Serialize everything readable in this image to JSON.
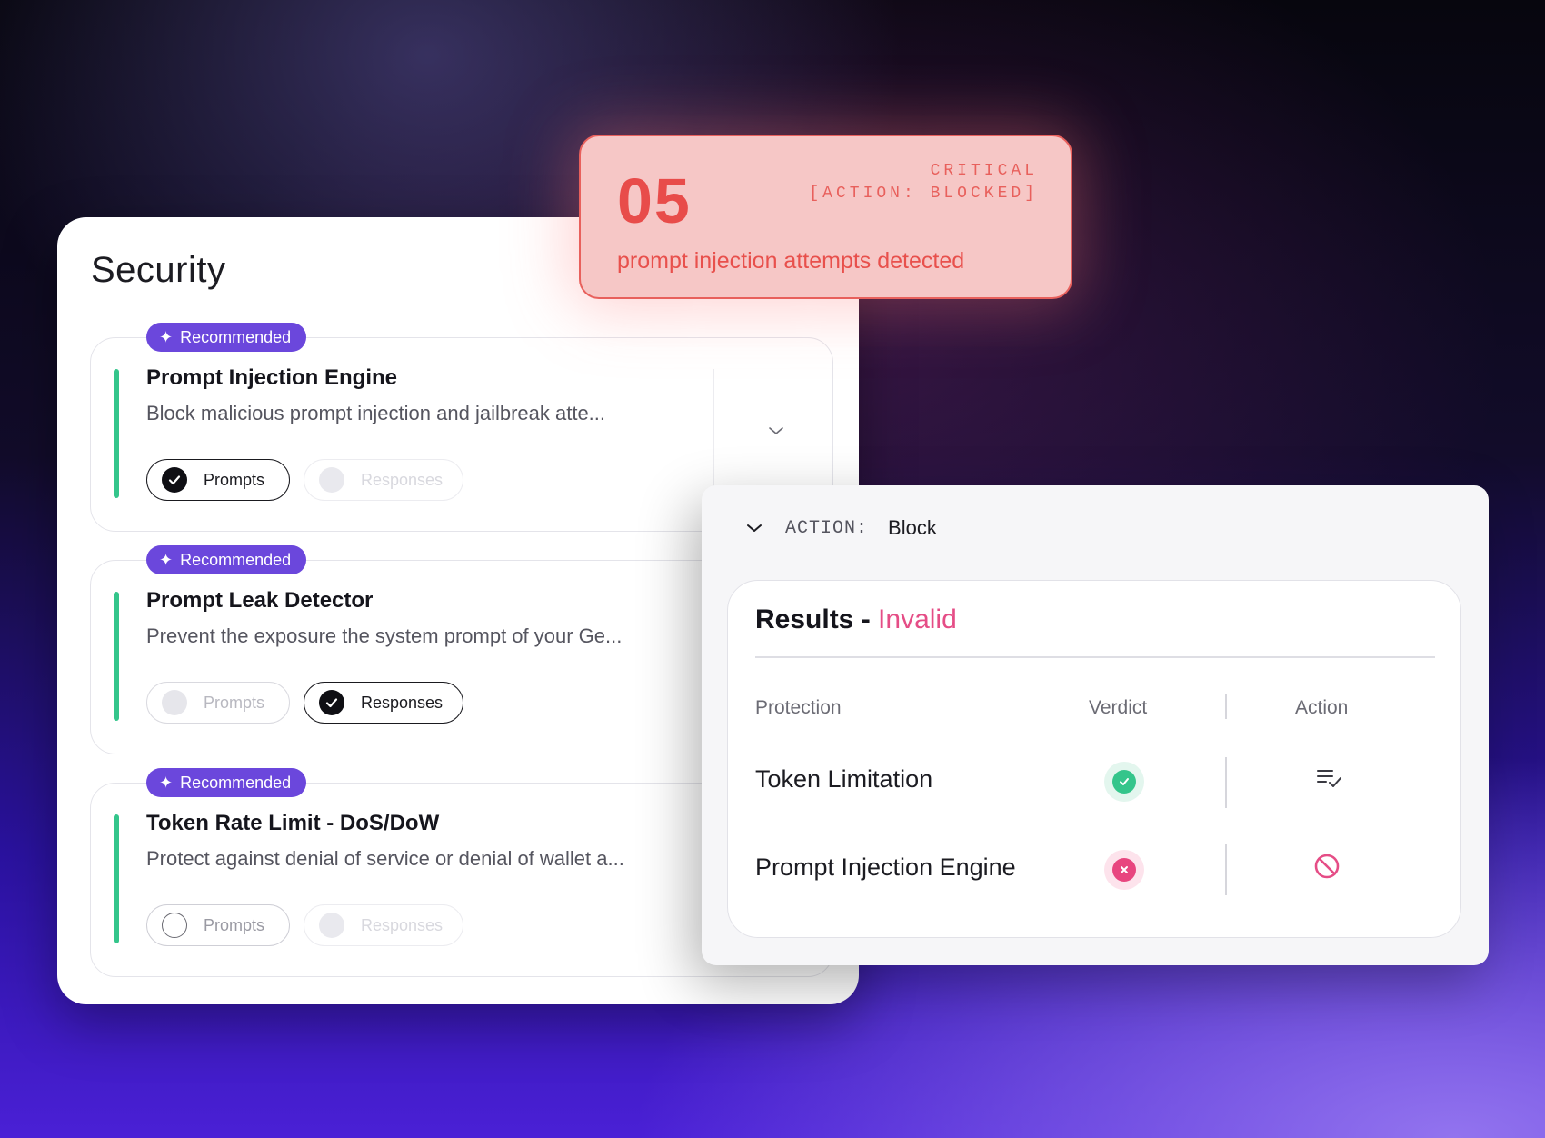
{
  "security": {
    "title": "Security",
    "cards": [
      {
        "badge": "Recommended",
        "title": "Prompt Injection Engine",
        "description": "Block malicious prompt injection and jailbreak atte...",
        "prompts_label": "Prompts",
        "prompts_state": "checked",
        "responses_label": "Responses",
        "responses_state": "disabled",
        "expandable": true
      },
      {
        "badge": "Recommended",
        "title": "Prompt Leak Detector",
        "description": "Prevent the exposure the system prompt of your Ge...",
        "prompts_label": "Prompts",
        "prompts_state": "disabled",
        "responses_label": "Responses",
        "responses_state": "checked"
      },
      {
        "badge": "Recommended",
        "title": "Token Rate Limit - DoS/DoW",
        "description": "Protect against denial of service or denial of wallet a...",
        "prompts_label": "Prompts",
        "prompts_state": "unchecked",
        "responses_label": "Responses",
        "responses_state": "disabled"
      }
    ]
  },
  "alert": {
    "count": "05",
    "severity": "CRITICAL",
    "action_status": "[ACTION: BLOCKED]",
    "message": "prompt injection attempts detected"
  },
  "results": {
    "action_key": "ACTION:",
    "action_value": "Block",
    "title": "Results -",
    "status": "Invalid",
    "columns": [
      "Protection",
      "Verdict",
      "Action"
    ],
    "rows": [
      {
        "protection": "Token Limitation",
        "verdict": "pass",
        "action": "list-check-icon"
      },
      {
        "protection": "Prompt Injection Engine",
        "verdict": "fail",
        "action": "block-icon"
      }
    ]
  },
  "colors": {
    "accent_green": "#34c58b",
    "badge_purple": "#6b47dc",
    "alert_red": "#e84c4a",
    "invalid_pink": "#e54d86"
  }
}
